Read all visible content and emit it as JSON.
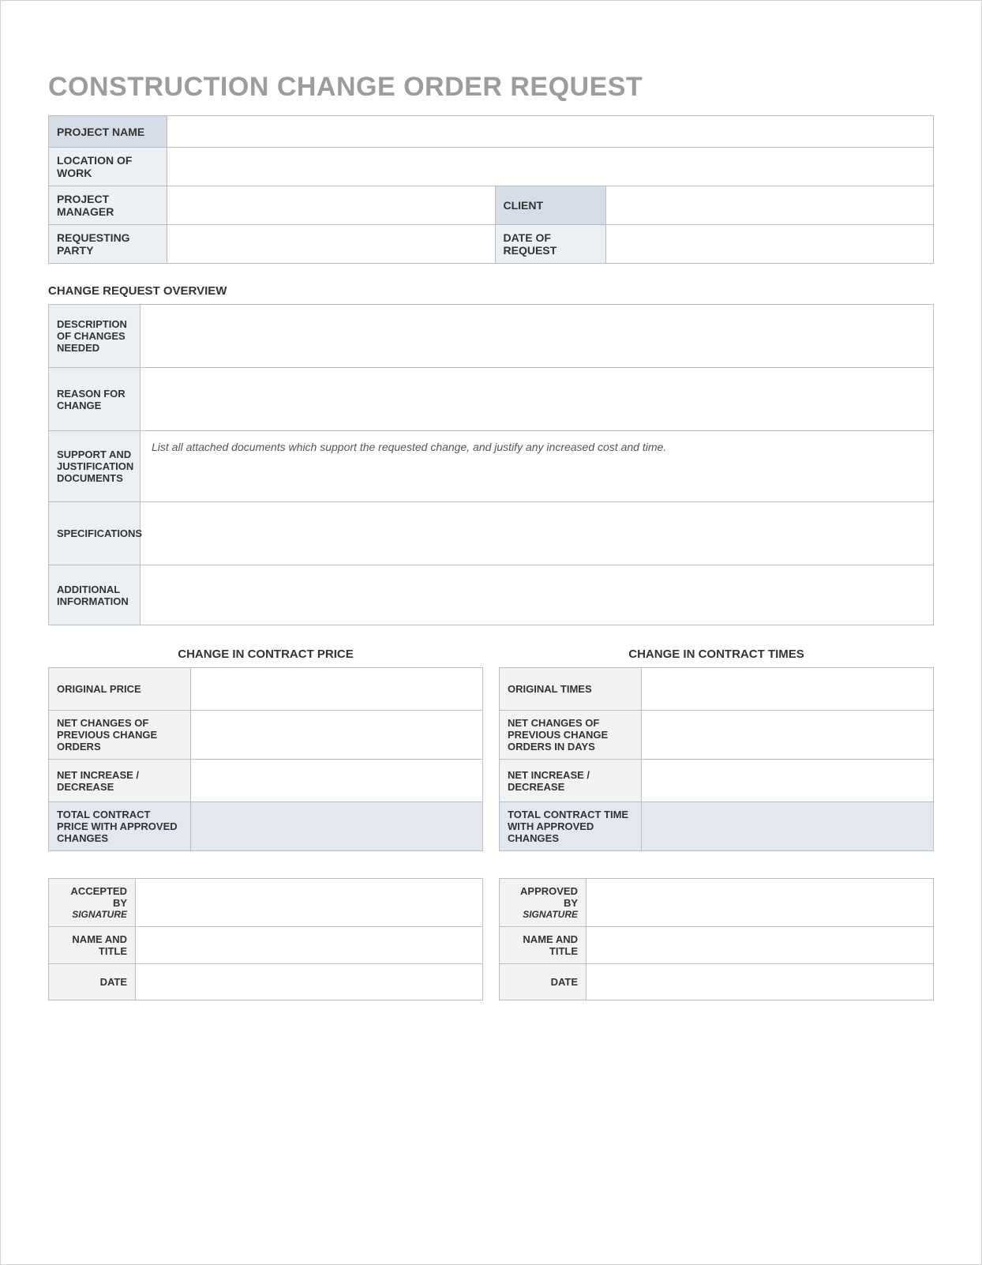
{
  "title": "CONSTRUCTION CHANGE ORDER REQUEST",
  "info": {
    "project_name_label": "PROJECT NAME",
    "project_name_value": "",
    "location_of_work_label": "LOCATION OF WORK",
    "location_of_work_value": "",
    "project_manager_label": "PROJECT MANAGER",
    "project_manager_value": "",
    "client_label": "CLIENT",
    "client_value": "",
    "requesting_party_label": "REQUESTING PARTY",
    "requesting_party_value": "",
    "date_of_request_label": "DATE OF REQUEST",
    "date_of_request_value": ""
  },
  "overview": {
    "heading": "CHANGE REQUEST OVERVIEW",
    "rows": [
      {
        "label": "DESCRIPTION OF CHANGES NEEDED",
        "value": ""
      },
      {
        "label": "REASON FOR CHANGE",
        "value": ""
      },
      {
        "label": "SUPPORT AND JUSTIFICATION DOCUMENTS",
        "value": "List all attached documents which support the requested change, and justify any increased cost and time."
      },
      {
        "label": "SPECIFICATIONS",
        "value": ""
      },
      {
        "label": "ADDITIONAL INFORMATION",
        "value": ""
      }
    ]
  },
  "price": {
    "heading": "CHANGE IN CONTRACT PRICE",
    "rows": [
      {
        "label": "ORIGINAL PRICE",
        "value": ""
      },
      {
        "label": "NET CHANGES OF PREVIOUS CHANGE ORDERS",
        "value": ""
      },
      {
        "label": "NET INCREASE / DECREASE",
        "value": ""
      },
      {
        "label": "TOTAL CONTRACT PRICE WITH APPROVED CHANGES",
        "value": ""
      }
    ]
  },
  "times": {
    "heading": "CHANGE IN CONTRACT TIMES",
    "rows": [
      {
        "label": "ORIGINAL TIMES",
        "value": ""
      },
      {
        "label": "NET CHANGES OF PREVIOUS CHANGE ORDERS IN DAYS",
        "value": ""
      },
      {
        "label": "NET INCREASE / DECREASE",
        "value": ""
      },
      {
        "label": "TOTAL CONTRACT TIME WITH APPROVED CHANGES",
        "value": ""
      }
    ]
  },
  "accepted": {
    "by_label": "ACCEPTED BY",
    "sig_label": "SIGNATURE",
    "name_title_label": "NAME AND TITLE",
    "date_label": "DATE",
    "signature_value": "",
    "name_title_value": "",
    "date_value": ""
  },
  "approved": {
    "by_label": "APPROVED BY",
    "sig_label": "SIGNATURE",
    "name_title_label": "NAME AND TITLE",
    "date_label": "DATE",
    "signature_value": "",
    "name_title_value": "",
    "date_value": ""
  }
}
